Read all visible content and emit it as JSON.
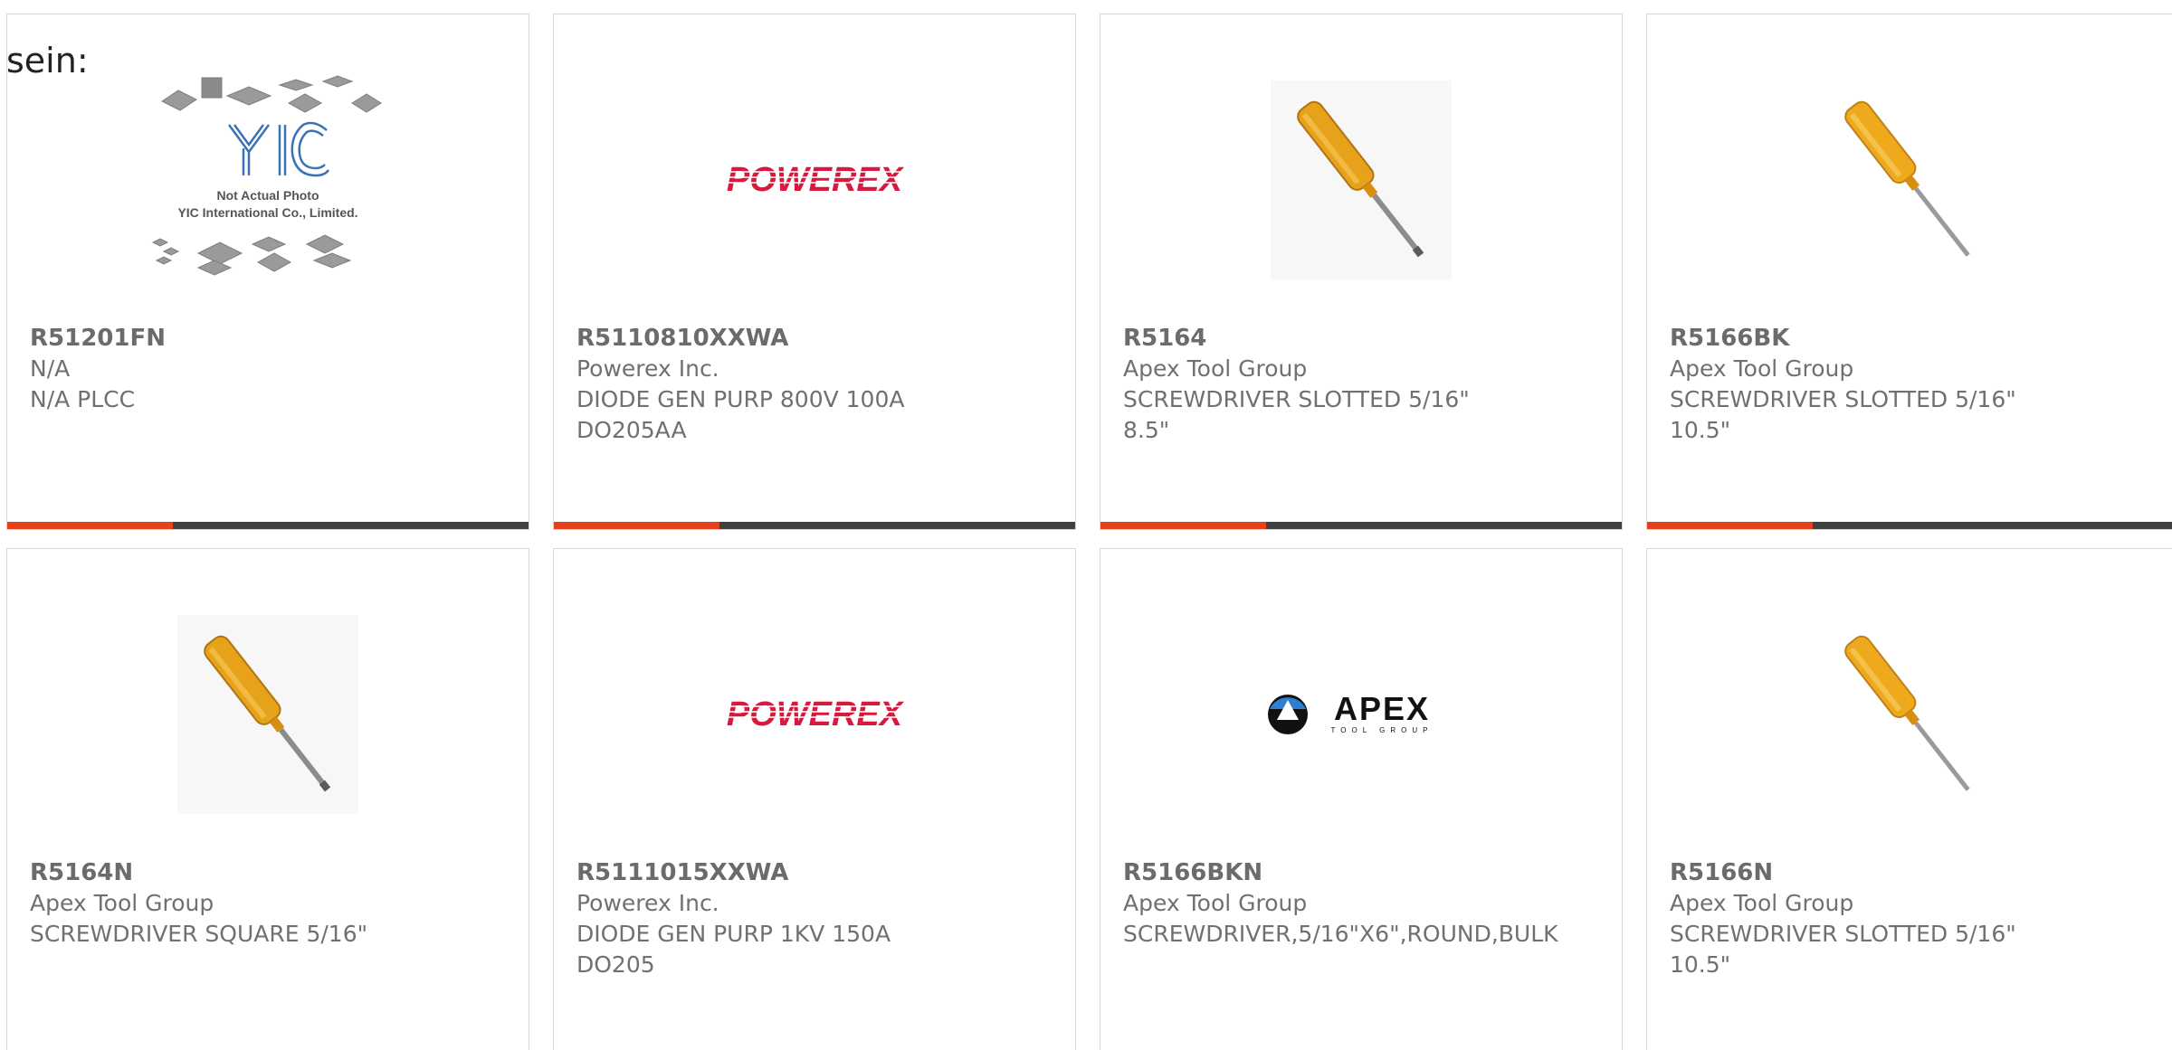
{
  "intro_text": "sein:",
  "colors": {
    "accent": "#e8401c",
    "bar_dark": "#404040",
    "powerex_red": "#d8183c",
    "screwdriver_handle": "#e6a21a"
  },
  "row1": [
    {
      "part_number": "R51201FN",
      "manufacturer": "N/A",
      "description": "N/A PLCC",
      "image": "yic-placeholder-image",
      "placeholder_caption_1": "Not Actual Photo",
      "placeholder_caption_2": "YIC International Co., Limited.",
      "placeholder_logo": "YIC"
    },
    {
      "part_number": "R5110810XXWA",
      "manufacturer": "Powerex Inc.",
      "description": "DIODE GEN PURP 800V 100A\nDO205AA",
      "image": "powerex-logo",
      "logo_text": "POWEREX"
    },
    {
      "part_number": "R5164",
      "manufacturer": "Apex Tool Group",
      "description": "SCREWDRIVER SLOTTED 5/16\"\n8.5\"",
      "image": "screwdriver-photo"
    },
    {
      "part_number": "R5166BK",
      "manufacturer": "Apex Tool Group",
      "description": "SCREWDRIVER SLOTTED 5/16\"\n10.5\"",
      "image": "screwdriver-photo"
    }
  ],
  "row2": [
    {
      "part_number": "R5164N",
      "manufacturer": "Apex Tool Group",
      "description": "SCREWDRIVER SQUARE 5/16\"",
      "image": "screwdriver-photo"
    },
    {
      "part_number": "R5111015XXWA",
      "manufacturer": "Powerex Inc.",
      "description": "DIODE GEN PURP 1KV 150A\nDO205",
      "image": "powerex-logo",
      "logo_text": "POWEREX"
    },
    {
      "part_number": "R5166BKN",
      "manufacturer": "Apex Tool Group",
      "description": "SCREWDRIVER,5/16\"X6\",ROUND,BULK",
      "image": "apex-logo",
      "logo_text": "APEX",
      "logo_subtext": "TOOL GROUP"
    },
    {
      "part_number": "R5166N",
      "manufacturer": "Apex Tool Group",
      "description": "SCREWDRIVER SLOTTED 5/16\"\n10.5\"",
      "image": "screwdriver-photo"
    }
  ]
}
